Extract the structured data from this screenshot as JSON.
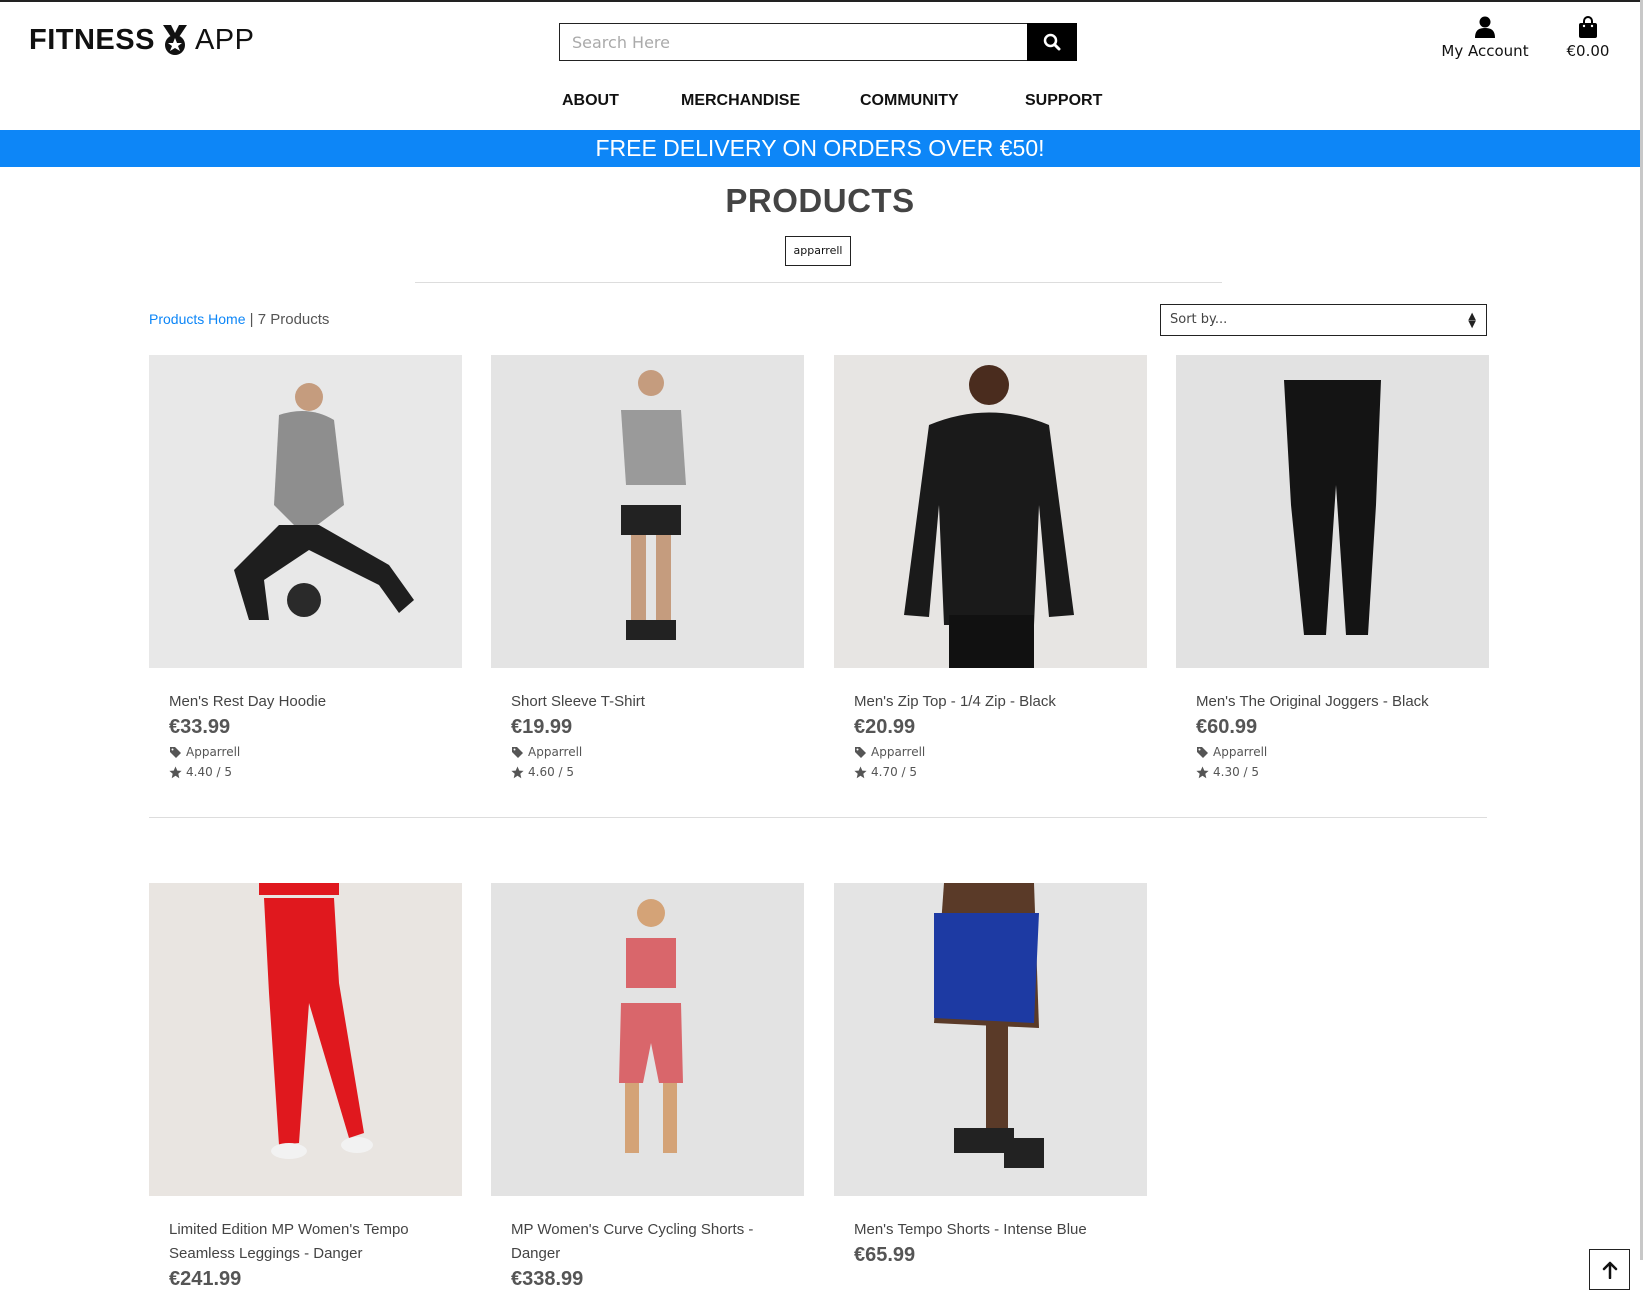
{
  "header": {
    "logo_left": "FITNESS",
    "logo_right": "APP",
    "search_placeholder": "Search Here",
    "account_label": "My Account",
    "cart_total": "€0.00"
  },
  "nav": {
    "items": [
      "ABOUT",
      "MERCHANDISE",
      "COMMUNITY",
      "SUPPORT"
    ]
  },
  "banner": "FREE DELIVERY ON ORDERS OVER €50!",
  "page": {
    "title": "PRODUCTS",
    "active_filter": "apparrell",
    "breadcrumb_link": "Products Home",
    "product_count": "| 7 Products",
    "sort_label": "Sort by..."
  },
  "products": [
    {
      "name": "Men's Rest Day Hoodie",
      "price": "€33.99",
      "category": "Apparrell",
      "rating": "4.40 / 5",
      "color": "#8e8e8e"
    },
    {
      "name": "Short Sleeve T-Shirt",
      "price": "€19.99",
      "category": "Apparrell",
      "rating": "4.60 / 5",
      "color": "#9a9a9a"
    },
    {
      "name": "Men's Zip Top - 1/4 Zip - Black",
      "price": "€20.99",
      "category": "Apparrell",
      "rating": "4.70 / 5",
      "color": "#1a1a1a"
    },
    {
      "name": "Men's The Original Joggers - Black",
      "price": "€60.99",
      "category": "Apparrell",
      "rating": "4.30 / 5",
      "color": "#141414"
    },
    {
      "name": "Limited Edition MP Women's Tempo Seamless Leggings - Danger",
      "price": "€241.99",
      "color": "#e0181e"
    },
    {
      "name": "MP Women's Curve Cycling Shorts - Danger",
      "price": "€338.99",
      "color": "#d9666b"
    },
    {
      "name": "Men's Tempo Shorts - Intense Blue",
      "price": "€65.99",
      "color": "#1d3aa3"
    }
  ]
}
